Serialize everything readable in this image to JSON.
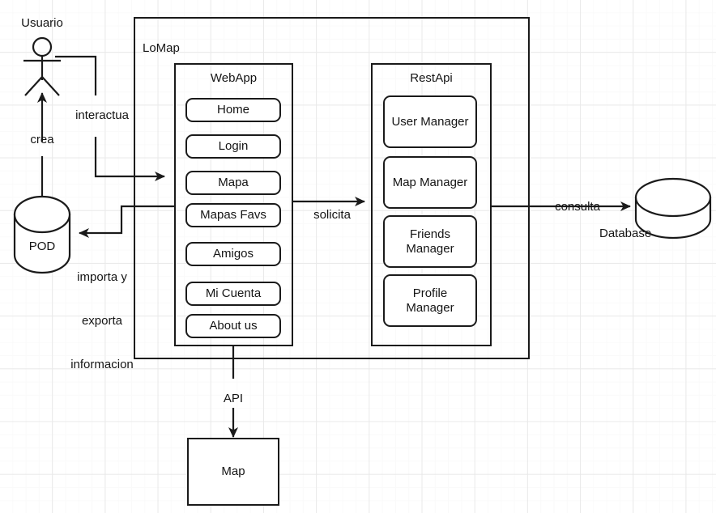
{
  "diagram": {
    "title": "LoMap architecture diagram",
    "style": {
      "line_color": "#1a1a1a",
      "text_color": "#141414",
      "background": "#ffffff",
      "grid_color": "#e9e9e9"
    },
    "actors": [
      {
        "id": "usuario",
        "label": "Usuario",
        "shape": "stick-figure"
      }
    ],
    "datastores": [
      {
        "id": "pod",
        "label": "POD",
        "shape": "cylinder"
      },
      {
        "id": "database",
        "label": "Database",
        "shape": "cylinder"
      }
    ],
    "containers": [
      {
        "id": "lomap",
        "label": "LoMap",
        "children": [
          {
            "id": "webapp",
            "label": "WebApp",
            "items": [
              {
                "label": "Home"
              },
              {
                "label": "Login"
              },
              {
                "label": "Mapa"
              },
              {
                "label": "Mapas Favs"
              },
              {
                "label": "Amigos"
              },
              {
                "label": "Mi Cuenta"
              },
              {
                "label": "About us"
              }
            ]
          },
          {
            "id": "restapi",
            "label": "RestApi",
            "items": [
              {
                "label": "User Manager"
              },
              {
                "label": "Map Manager"
              },
              {
                "label": "Friends\nManager"
              },
              {
                "label": "Profile\nManager"
              }
            ]
          }
        ]
      }
    ],
    "external_nodes": [
      {
        "id": "map",
        "label": "Map",
        "shape": "rectangle"
      }
    ],
    "edge_labels": {
      "crea": "crea",
      "interactua": "interactua",
      "importa": "importa y\nexporta\ninformacion",
      "importa_line1": "importa y",
      "importa_line2": "exporta",
      "importa_line3": "informacion",
      "solicita": "solicita",
      "consulta": "consulta",
      "api": "API"
    },
    "edges": [
      {
        "from": "pod",
        "to": "usuario",
        "label": "crea"
      },
      {
        "from": "usuario",
        "to": "webapp",
        "label": "interactua"
      },
      {
        "from": "webapp",
        "to": "pod",
        "label": "importa y exporta informacion"
      },
      {
        "from": "webapp",
        "to": "restapi",
        "label": "solicita"
      },
      {
        "from": "restapi",
        "to": "database",
        "label": "consulta"
      },
      {
        "from": "webapp",
        "to": "map",
        "label": "API"
      }
    ]
  }
}
